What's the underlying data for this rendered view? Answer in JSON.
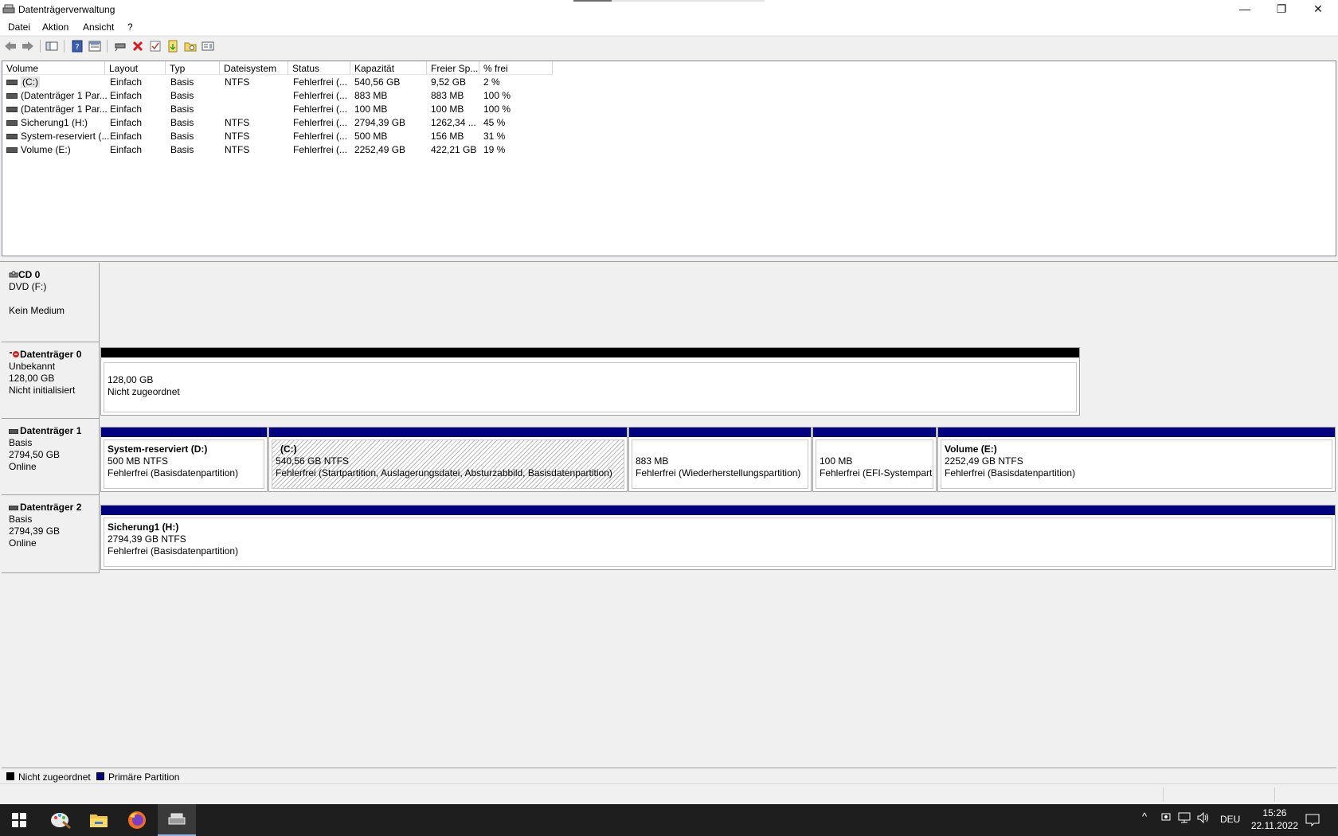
{
  "window": {
    "title": "Datenträgerverwaltung",
    "minimize_glyph": "—",
    "restore_glyph": "❐",
    "close_glyph": "✕"
  },
  "menu": [
    "Datei",
    "Aktion",
    "Ansicht",
    "?"
  ],
  "toolbar": {
    "icons": [
      "back-icon",
      "forward-icon",
      "show-hide-console-tree-icon",
      "help-icon",
      "properties-icon",
      "connect-icon",
      "delete-icon",
      "check-icon",
      "new-volume-icon",
      "open-icon",
      "settings-icon"
    ]
  },
  "volume_list": {
    "columns": [
      "Volume",
      "Layout",
      "Typ",
      "Dateisystem",
      "Status",
      "Kapazität",
      "Freier Sp...",
      "% frei"
    ],
    "rows": [
      [
        "(C:)",
        "Einfach",
        "Basis",
        "NTFS",
        "Fehlerfrei (...",
        "540,56 GB",
        "9,52 GB",
        "2 %"
      ],
      [
        "(Datenträger 1 Par...",
        "Einfach",
        "Basis",
        "",
        "Fehlerfrei (...",
        "883 MB",
        "883 MB",
        "100 %"
      ],
      [
        "(Datenträger 1 Par...",
        "Einfach",
        "Basis",
        "",
        "Fehlerfrei (...",
        "100 MB",
        "100 MB",
        "100 %"
      ],
      [
        "Sicherung1 (H:)",
        "Einfach",
        "Basis",
        "NTFS",
        "Fehlerfrei (...",
        "2794,39 GB",
        "1262,34 ...",
        "45 %"
      ],
      [
        "System-reserviert (...",
        "Einfach",
        "Basis",
        "NTFS",
        "Fehlerfrei (...",
        "500 MB",
        "156 MB",
        "31 %"
      ],
      [
        "Volume (E:)",
        "Einfach",
        "Basis",
        "NTFS",
        "Fehlerfrei (...",
        "2252,49 GB",
        "422,21 GB",
        "19 %"
      ]
    ]
  },
  "disks": {
    "cd0": {
      "name": "CD 0",
      "line1": "DVD (F:)",
      "line2": "",
      "line3": "Kein Medium"
    },
    "disk0": {
      "name": "Datenträger 0",
      "line1": "Unbekannt",
      "line2": "128,00 GB",
      "line3": "Nicht initialisiert",
      "part": {
        "line1": "128,00 GB",
        "line2": "Nicht zugeordnet"
      }
    },
    "disk1": {
      "name": "Datenträger 1",
      "line1": "Basis",
      "line2": "2794,50 GB",
      "line3": "Online",
      "parts": [
        {
          "title": "System-reserviert  (D:)",
          "line1": "500 MB NTFS",
          "line2": "Fehlerfrei (Basisdatenpartition)"
        },
        {
          "title": "(C:)",
          "line1": "540,56 GB NTFS",
          "line2": "Fehlerfrei (Startpartition, Auslagerungsdatei, Absturzabbild, Basisdatenpartition)"
        },
        {
          "title": "",
          "line1": "883 MB",
          "line2": "Fehlerfrei (Wiederherstellungspartition)"
        },
        {
          "title": "",
          "line1": "100 MB",
          "line2": "Fehlerfrei (EFI-Systempartit"
        },
        {
          "title": "Volume  (E:)",
          "line1": "2252,49 GB NTFS",
          "line2": "Fehlerfrei (Basisdatenpartition)"
        }
      ]
    },
    "disk2": {
      "name": "Datenträger 2",
      "line1": "Basis",
      "line2": "2794,39 GB",
      "line3": "Online",
      "part": {
        "title": "Sicherung1  (H:)",
        "line1": "2794,39 GB NTFS",
        "line2": "Fehlerfrei (Basisdatenpartition)"
      }
    }
  },
  "legend": [
    {
      "label": "Nicht zugeordnet",
      "color": "#000000"
    },
    {
      "label": "Primäre Partition",
      "color": "#000080"
    }
  ],
  "colors": {
    "primary_partition": "#000080",
    "unallocated": "#000000"
  },
  "taskbar": {
    "apps": [
      "windows-start-icon",
      "paint-icon",
      "file-explorer-icon",
      "firefox-icon",
      "disk-management-icon"
    ],
    "tray": {
      "lang": "DEU",
      "time": "15:26",
      "date": "22.11.2022"
    }
  }
}
